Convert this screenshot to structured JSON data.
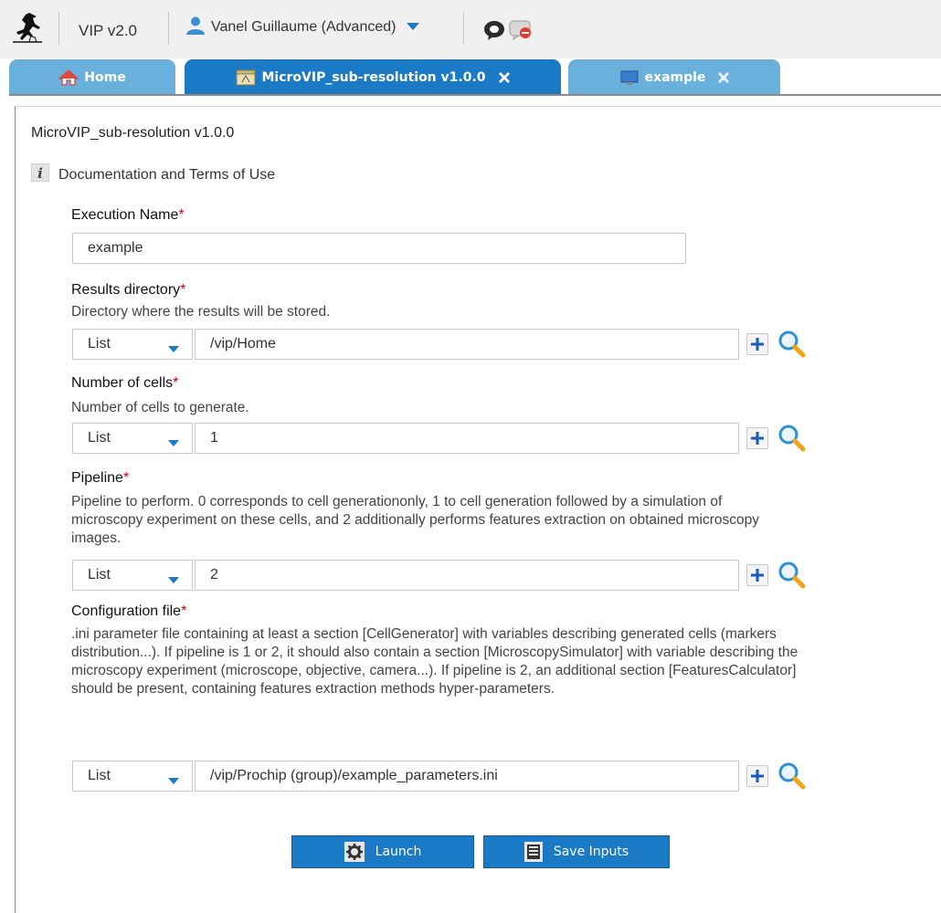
{
  "header": {
    "app_version": "VIP v2.0",
    "user_name": "Vanel Guillaume (Advanced)"
  },
  "tabs": [
    {
      "label": "Home",
      "icon": "home-icon"
    },
    {
      "label": "MicroVIP_sub-resolution v1.0.0",
      "icon": "application-icon"
    },
    {
      "label": "example",
      "icon": "monitor-icon"
    }
  ],
  "main": {
    "title": "MicroVIP_sub-resolution v1.0.0",
    "doc_link": "Documentation and Terms of Use",
    "execution_name": {
      "label": "Execution Name",
      "required": "*",
      "value": "example"
    },
    "fields": [
      {
        "label": "Results directory",
        "required": "*",
        "description": "Directory where the results will be stored.",
        "mode": "List",
        "value": "/vip/Home"
      },
      {
        "label": "Number of cells",
        "required": "*",
        "description": "Number of cells to generate.",
        "mode": "List",
        "value": "1"
      },
      {
        "label": "Pipeline",
        "required": "*",
        "description": "Pipeline to perform. 0 corresponds to cell generationonly, 1 to cell generation followed by a simulation of microscopy experiment on these cells, and 2 additionally performs features extraction on obtained microscopy images.",
        "mode": "List",
        "value": "2"
      },
      {
        "label": "Configuration file",
        "required": "*",
        "description": ".ini parameter file containing at least a section [CellGenerator] with variables describing generated cells (markers distribution...). If pipeline is 1 or 2, it should also contain a section [MicroscopySimulator] with variable describing the microscopy experiment (microscope, objective, camera...). If pipeline is 2, an additional section [FeaturesCalculator] should be present, containing features extraction methods hyper-parameters.",
        "mode": "List",
        "value": "/vip/Prochip (group)/example_parameters.ini"
      }
    ]
  },
  "actions": {
    "launch_label": "Launch",
    "save_label": "Save Inputs"
  },
  "colors": {
    "tab_active": "#1a7ac6",
    "tab_inactive": "#6ab0dd",
    "required": "#d40000"
  }
}
